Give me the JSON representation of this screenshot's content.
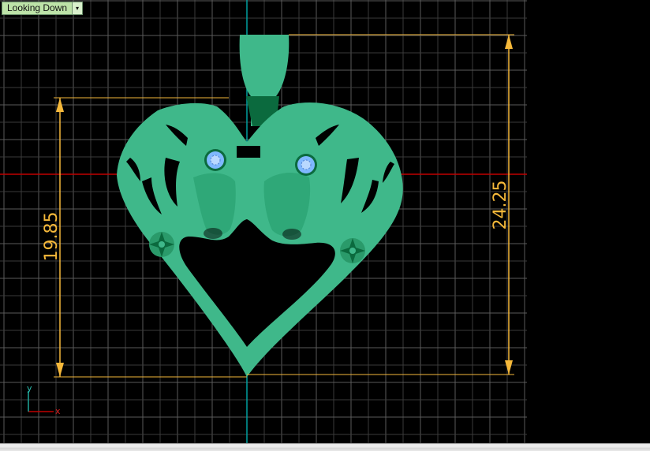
{
  "viewport": {
    "view_name": "Looking Down",
    "dropdown_arrow": "▾"
  },
  "dimensions": {
    "left_height": "19.85",
    "right_height": "24.25"
  },
  "axis_icon": {
    "x_label": "x",
    "y_label": "y"
  },
  "icons": [
    "chevron-down-icon",
    "axis-gizmo-icon",
    "gemstone-icon",
    "flower-ornament-icon"
  ],
  "colors": {
    "background": "#000000",
    "grid_minor": "#3a3a3a",
    "grid_major": "#5a5a5a",
    "model": "#3fb88a",
    "model_dark": "#0b6a3e",
    "dimension": "#f5b83a",
    "x_axis_line": "#c00000",
    "y_axis_line": "#00a0a0",
    "gem": "#7fb8ff"
  }
}
